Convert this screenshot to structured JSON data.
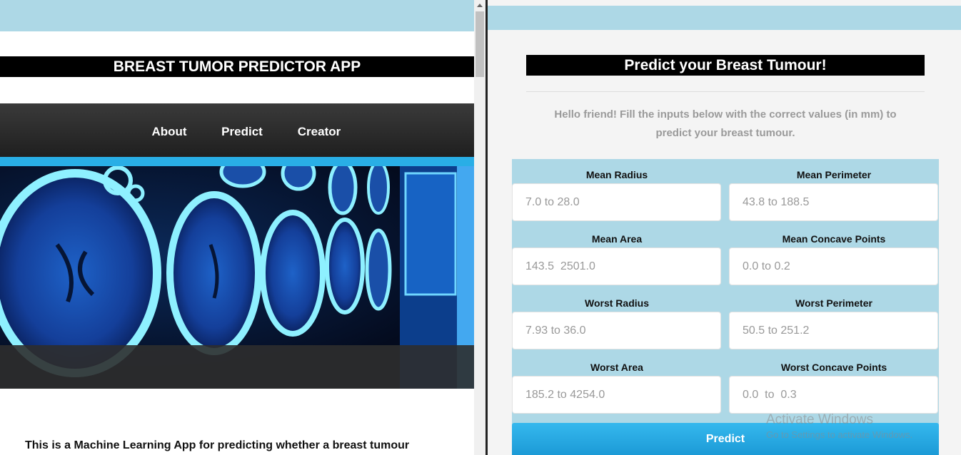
{
  "left_app": {
    "title": "BREAST TUMOR PREDICTOR APP",
    "nav": [
      {
        "label": "About"
      },
      {
        "label": "Predict"
      },
      {
        "label": "Creator"
      }
    ],
    "intro_text": "This is a Machine Learning App for predicting whether a breast tumour"
  },
  "right_app": {
    "title": "Predict your Breast Tumour!",
    "subtitle_line1": "Hello friend! Fill the inputs below with the correct values (in mm) to",
    "subtitle_line2": "predict your breast tumour.",
    "fields": [
      {
        "label": "Mean Radius",
        "placeholder": "7.0 to 28.0"
      },
      {
        "label": "Mean Perimeter",
        "placeholder": "43.8 to 188.5"
      },
      {
        "label": "Mean Area",
        "placeholder": "143.5  2501.0"
      },
      {
        "label": "Mean Concave Points",
        "placeholder": "0.0 to 0.2"
      },
      {
        "label": "Worst Radius",
        "placeholder": "7.93 to 36.0"
      },
      {
        "label": "Worst Perimeter",
        "placeholder": "50.5 to 251.2"
      },
      {
        "label": "Worst Area",
        "placeholder": "185.2 to 4254.0"
      },
      {
        "label": "Worst Concave Points",
        "placeholder": "0.0  to  0.3"
      }
    ],
    "predict_label": "Predict"
  },
  "watermark": {
    "line1": "Activate Windows",
    "line2": "Go to Settings to activate Windows."
  },
  "colors": {
    "light_blue": "#add8e6",
    "accent_blue": "#29aee6",
    "title_bg": "#000000"
  }
}
